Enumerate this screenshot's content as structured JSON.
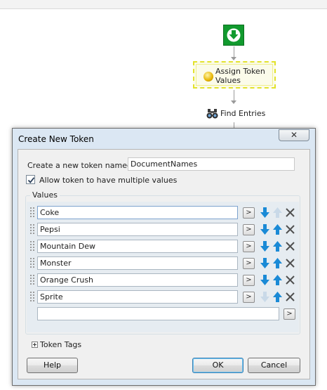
{
  "workflow": {
    "assign_node_label": "Assign Token Values",
    "find_node_label": "Find Entries"
  },
  "dialog": {
    "title": "Create New Token",
    "close_symbol": "✕",
    "name_label": "Create a new token named:",
    "name_value": "DocumentNames",
    "allow_multiple_label": "Allow token to have multiple values",
    "allow_multiple_checked": true,
    "values_label": "Values",
    "values": [
      "Coke",
      "Pepsi",
      "Mountain Dew",
      "Monster",
      "Orange Crush",
      "Sprite"
    ],
    "new_value": "",
    "more_button_label": ">",
    "token_tags_label": "Token Tags",
    "help_label": "Help",
    "ok_label": "OK",
    "cancel_label": "Cancel"
  },
  "icons": {
    "start": "arrow-down-circle-icon",
    "assign": "token-coin-icon",
    "find": "binoculars-icon",
    "grip": "drag-grip-icon",
    "move_down": "arrow-down-icon",
    "move_up": "arrow-up-icon",
    "delete": "x-delete-icon",
    "expand": "plus-expand-icon"
  },
  "colors": {
    "start_node": "#119a2e",
    "arrow_active": "#1a8ad6",
    "arrow_disabled": "#c9d9e8",
    "delete": "#505050",
    "selected_node_border": "#e2e22c",
    "dialog_frame": "#dbe7f3"
  }
}
